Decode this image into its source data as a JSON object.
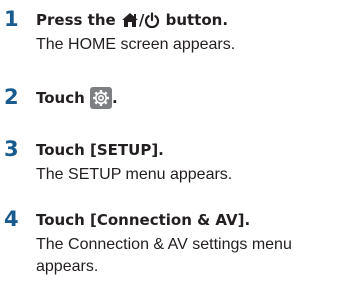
{
  "steps": [
    {
      "number": "1",
      "head_prefix": "Press the ",
      "head_sep": "/",
      "head_suffix": " button.",
      "result": "The HOME screen appears.",
      "icons": [
        "home-icon",
        "power-icon"
      ]
    },
    {
      "number": "2",
      "head_prefix": "Touch ",
      "head_suffix": ".",
      "icons": [
        "settings-gear-icon"
      ]
    },
    {
      "number": "3",
      "head": "Touch [SETUP].",
      "result": "The SETUP menu appears."
    },
    {
      "number": "4",
      "head": "Touch [Connection & AV].",
      "result_line1": "The Connection & AV settings menu",
      "result_line2": "appears."
    }
  ],
  "colors": {
    "step_number": "#1a5b8f",
    "text": "#231f20",
    "gear_button_bg": "#7e7f82"
  }
}
